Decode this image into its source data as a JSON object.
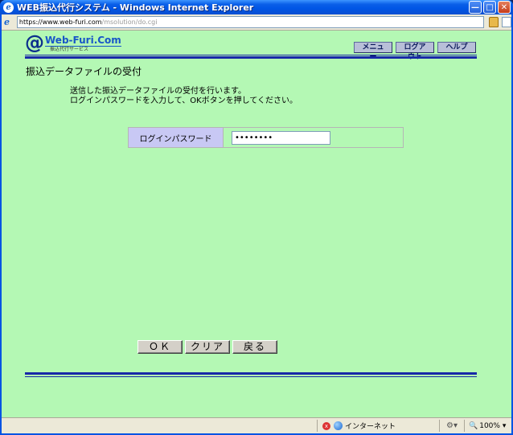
{
  "window": {
    "title": "WEB振込代行システム - Windows Internet Explorer"
  },
  "address": {
    "url_prefix": "https://www.",
    "url_host": "web-furi.com",
    "url_path": "/msolution/do.cgi"
  },
  "logo": {
    "at": "@",
    "name": "Web-Furi.Com",
    "subtitle": "振込代行サービス"
  },
  "nav": {
    "menu": "メニュー",
    "logout": "ログアウト",
    "help": "ヘルプ"
  },
  "page": {
    "title": "振込データファイルの受付",
    "desc_line1": "送信した振込データファイルの受付を行います。",
    "desc_line2": "ログインパスワードを入力して、OKボタンを押してください。"
  },
  "form": {
    "password_label": "ログインパスワード",
    "password_value": "••••••••"
  },
  "buttons": {
    "ok": "ＯＫ",
    "clear": "クリア",
    "back": "戻る"
  },
  "status": {
    "zone": "インターネット",
    "zoom": "100%"
  },
  "colors": {
    "page_background": "#b4f8b4",
    "rule_blue": "#1828a8",
    "label_cell": "#c8c8f4"
  }
}
